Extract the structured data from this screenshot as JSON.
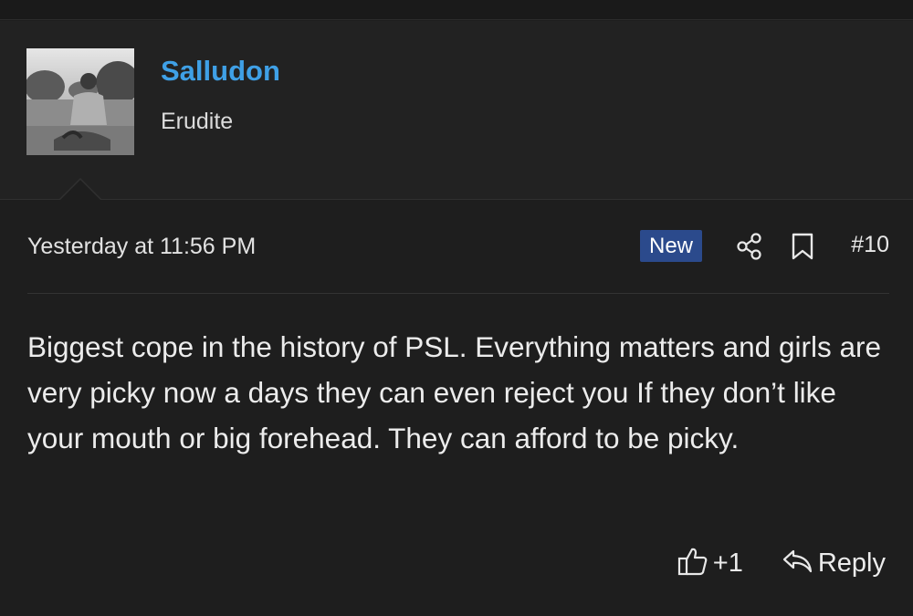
{
  "user": {
    "name": "Salludon",
    "title": "Erudite",
    "avatar_icon": "user-avatar-photo"
  },
  "post": {
    "timestamp": "Yesterday at 11:56 PM",
    "badge": "New",
    "number": "#10",
    "body": "Biggest cope in the history of PSL. Everything matters and girls are very picky now a days they can even reject you If they don’t like your mouth or big forehead. They can afford to be picky."
  },
  "actions": {
    "like_count": "+1",
    "reply_label": "Reply",
    "like_icon": "thumbs-up-icon",
    "reply_icon": "reply-arrow-icon",
    "share_icon": "share-icon",
    "bookmark_icon": "bookmark-icon"
  },
  "colors": {
    "background": "#1e1e1e",
    "header_background": "#222222",
    "username": "#3fa0e6",
    "badge_background": "#2b4a8c",
    "text": "#ececec"
  }
}
